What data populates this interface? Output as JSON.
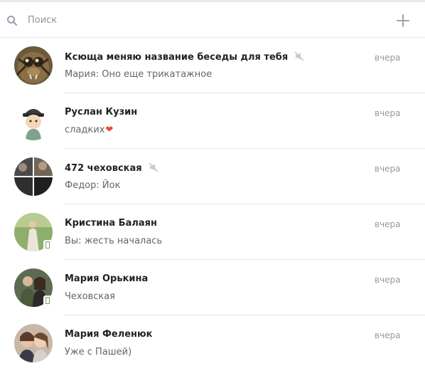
{
  "search": {
    "placeholder": "Поиск"
  },
  "dialogs": [
    {
      "name": "Ксюща меняю название беседы для тебя",
      "muted": true,
      "time": "вчера",
      "message": "Мария: Оно еще трикатажное",
      "avatar": "spider-avatar"
    },
    {
      "name": "Руслан Кузин",
      "muted": false,
      "time": "вчера",
      "message": "сладких",
      "emoji": "heart",
      "avatar": "cartoon-avatar"
    },
    {
      "name": "472 чеховская",
      "muted": true,
      "time": "вчера",
      "message": "Федор: Йок",
      "avatar": "group-collage-avatar"
    },
    {
      "name": "Кристина Балаян",
      "muted": false,
      "time": "вчера",
      "message": "Вы: жесть началась",
      "avatar": "photo-avatar",
      "mobile_online": true
    },
    {
      "name": "Мария Орькина",
      "muted": false,
      "time": "вчера",
      "message": "Чеховская",
      "avatar": "photo-avatar",
      "mobile_online": true
    },
    {
      "name": "Мария Феленюк",
      "muted": false,
      "time": "вчера",
      "message": "Уже с Пашей)",
      "avatar": "photo-avatar"
    }
  ],
  "colors": {
    "text": "#222222",
    "muted_text": "#656565",
    "time": "#939aa3",
    "separator": "#e7e8ec",
    "accent": "#5181b8",
    "heart": "#e84b3a"
  }
}
